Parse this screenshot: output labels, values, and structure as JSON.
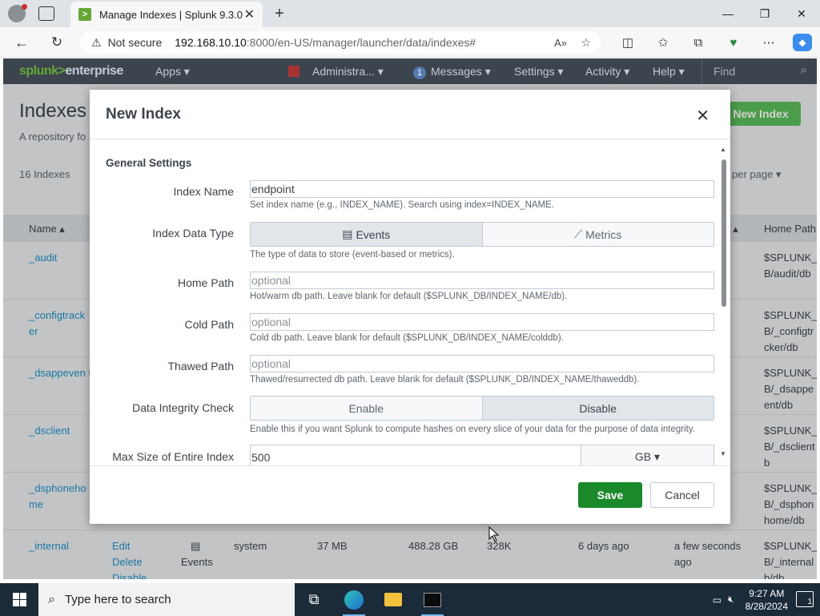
{
  "browser": {
    "tab_title": "Manage Indexes | Splunk 9.3.0",
    "security_label": "Not secure",
    "url_host": "192.168.10.10",
    "url_path": ":8000/en-US/manager/launcher/data/indexes#"
  },
  "splunk_bar": {
    "logo_brand": "splunk>",
    "logo_product": "enterprise",
    "apps": "Apps ▾",
    "admin": "Administra... ▾",
    "messages_count": "1",
    "messages": "Messages ▾",
    "settings": "Settings ▾",
    "activity": "Activity ▾",
    "help": "Help ▾",
    "find": "Find"
  },
  "page": {
    "title": "Indexes",
    "subtitle": "A repository fo",
    "new_index_button": "New Index",
    "count": "16 Indexes",
    "per_page": "per page ▾",
    "col_name": "Name ▴",
    "col_frozen": "t ▴",
    "col_home": "Home Path",
    "rows": [
      {
        "name": "_audit",
        "home": "$SPLUNK_ B/audit/db"
      },
      {
        "name": "_configtrack er",
        "home": "$SPLUNK_ B/_configtr cker/db"
      },
      {
        "name": "_dsappeven t",
        "home": "$SPLUNK_ B/_dsappe ent/db"
      },
      {
        "name": "_dsclient",
        "home": "$SPLUNK_ B/_dsclient b"
      },
      {
        "name": "_dsphoneho me",
        "home": "$SPLUNK_ B/_dsphon home/db"
      },
      {
        "name": "_internal",
        "home": "$SPLUNK_ B/_internal b/db",
        "action": "Edit",
        "action2": "Delete",
        "action3": "Disable",
        "type": "Events",
        "app": "system",
        "size": "37 MB",
        "max": "488.28 GB",
        "events": "328K",
        "earliest": "6 days ago",
        "latest": "a few seconds ago"
      }
    ]
  },
  "modal": {
    "title": "New Index",
    "section": "General Settings",
    "index_name_label": "Index Name",
    "index_name_value": "endpoint",
    "index_name_help": "Set index name (e.g., INDEX_NAME). Search using index=INDEX_NAME.",
    "data_type_label": "Index Data Type",
    "data_type_events": "Events",
    "data_type_metrics": "Metrics",
    "data_type_help": "The type of data to store (event-based or metrics).",
    "home_path_label": "Home Path",
    "home_path_placeholder": "optional",
    "home_path_help": "Hot/warm db path. Leave blank for default ($SPLUNK_DB/INDEX_NAME/db).",
    "cold_path_label": "Cold Path",
    "cold_path_placeholder": "optional",
    "cold_path_help": "Cold db path. Leave blank for default ($SPLUNK_DB/INDEX_NAME/colddb).",
    "thawed_path_label": "Thawed Path",
    "thawed_path_placeholder": "optional",
    "thawed_path_help": "Thawed/resurrected db path. Leave blank for default ($SPLUNK_DB/INDEX_NAME/thaweddb).",
    "integrity_label": "Data Integrity Check",
    "integrity_enable": "Enable",
    "integrity_disable": "Disable",
    "integrity_help": "Enable this if you want Splunk to compute hashes on every slice of your data for the purpose of data integrity.",
    "max_size_label": "Max Size of Entire Index",
    "max_size_value": "500",
    "max_size_unit": "GB ▾",
    "save": "Save",
    "cancel": "Cancel"
  },
  "taskbar": {
    "search_placeholder": "Type here to search",
    "time": "9:27 AM",
    "date": "8/28/2024",
    "notifications": "1"
  }
}
